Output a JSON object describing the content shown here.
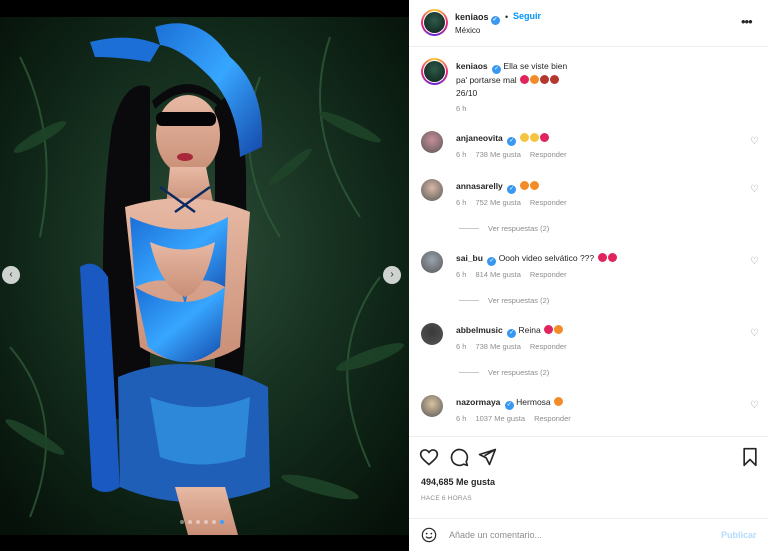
{
  "post": {
    "author": "keniaos",
    "follow_label": "Seguir",
    "separator": "•",
    "location": "México",
    "more_label": "•••"
  },
  "media": {
    "prev_label": "‹",
    "next_label": "›",
    "dots_count": 6,
    "active_dot": 5
  },
  "caption": {
    "author": "keniaos",
    "line1": "Ella se viste bien",
    "line2": "pa' portarse mal",
    "line3": "26/10",
    "time": "6 h"
  },
  "comments": [
    {
      "user": "anjaneovita",
      "text": "",
      "time": "6 h",
      "likes": "738 Me gusta",
      "reply": "Responder",
      "view_replies": "",
      "emojis": [
        "#f5c542",
        "#f5c542",
        "#e0245e"
      ]
    },
    {
      "user": "annasarelly",
      "text": "",
      "time": "6 h",
      "likes": "752 Me gusta",
      "reply": "Responder",
      "view_replies": "Ver respuestas (2)",
      "emojis": [
        "#f28c28",
        "#f28c28"
      ]
    },
    {
      "user": "sai_bu",
      "text": "Oooh video selvático ???",
      "time": "6 h",
      "likes": "814 Me gusta",
      "reply": "Responder",
      "view_replies": "Ver respuestas (2)",
      "emojis": [
        "#e0245e",
        "#e0245e"
      ]
    },
    {
      "user": "abbelmusic",
      "text": "Reina",
      "time": "6 h",
      "likes": "738 Me gusta",
      "reply": "Responder",
      "view_replies": "Ver respuestas (2)",
      "emojis": [
        "#e0245e",
        "#f28c28"
      ]
    },
    {
      "user": "nazormaya",
      "text": "Hermosa",
      "time": "6 h",
      "likes": "1037 Me gusta",
      "reply": "Responder",
      "view_replies": "",
      "emojis": [
        "#f28c28"
      ]
    }
  ],
  "stats": {
    "likes": "494,685 Me gusta",
    "time_ago": "HACE 6 HORAS"
  },
  "add_comment": {
    "placeholder": "Añade un comentario...",
    "publish_label": "Publicar"
  },
  "colors": {
    "accent": "#0095f6",
    "verified": "#3897f0",
    "heart_red": "#e0245e"
  }
}
